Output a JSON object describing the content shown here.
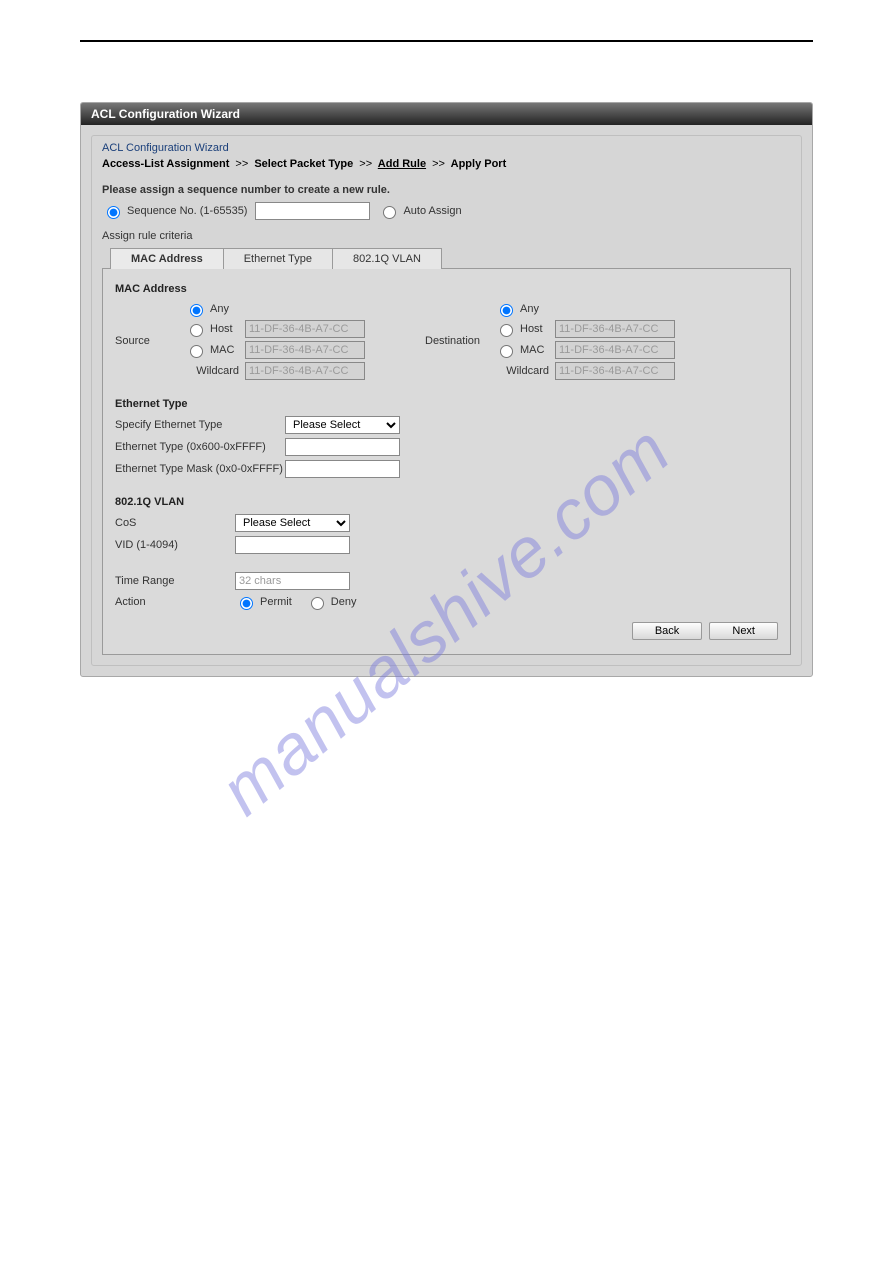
{
  "header": {
    "title": "ACL Configuration Wizard"
  },
  "sub": {
    "title": "ACL Configuration Wizard"
  },
  "watermark": "manualshive.com",
  "breadcrumb": {
    "step1": "Access-List Assignment",
    "sep": ">>",
    "step2": "Select Packet Type",
    "step3": "Add Rule",
    "step4": "Apply Port"
  },
  "sequence": {
    "instruction": "Please assign a sequence number to create a new rule.",
    "opt_seq": "Sequence No. (1-65535)",
    "opt_auto": "Auto Assign",
    "value": ""
  },
  "criteria_label": "Assign rule criteria",
  "tabs": {
    "mac": "MAC Address",
    "eth": "Ethernet Type",
    "vlan": "802.1Q VLAN"
  },
  "mac": {
    "title": "MAC Address",
    "source_label": "Source",
    "dest_label": "Destination",
    "opt_any": "Any",
    "opt_host": "Host",
    "opt_mac": "MAC",
    "wildcard": "Wildcard",
    "placeholder": "11-DF-36-4B-A7-CC"
  },
  "eth": {
    "title": "Ethernet Type",
    "specify": "Specify Ethernet Type",
    "type_range": "Ethernet Type (0x600-0xFFFF)",
    "mask_range": "Ethernet Type Mask (0x0-0xFFFF)",
    "select_default": "Please Select"
  },
  "vlan": {
    "title": "802.1Q VLAN",
    "cos": "CoS",
    "vid": "VID (1-4094)",
    "select_default": "Please Select"
  },
  "timerange": {
    "label": "Time Range",
    "placeholder": "32 chars"
  },
  "action": {
    "label": "Action",
    "permit": "Permit",
    "deny": "Deny"
  },
  "buttons": {
    "back": "Back",
    "next": "Next"
  }
}
